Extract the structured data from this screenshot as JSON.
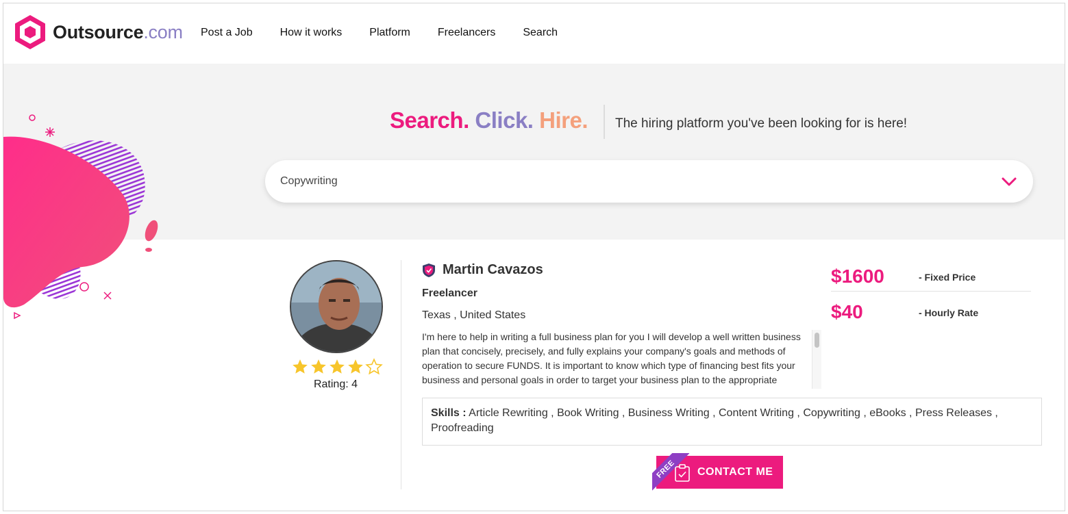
{
  "brand": {
    "name": "Outsource",
    "domain": ".com",
    "primary_color": "#ec1b7e",
    "secondary_color": "#8a7fc4"
  },
  "nav": {
    "items": [
      "Post a Job",
      "How it works",
      "Platform",
      "Freelancers",
      "Search"
    ]
  },
  "hero": {
    "tagline": {
      "part1": "Search.",
      "part2": "Click.",
      "part3": "Hire."
    },
    "subtitle": "The hiring platform you've been looking for is here!",
    "search": {
      "value": "Copywriting",
      "icon": "chevron-down-icon"
    }
  },
  "profile": {
    "name": "Martin Cavazos",
    "role": "Freelancer",
    "location": "Texas , United States",
    "bio": "I'm here to help in writing a full business plan for you I will develop a well written business plan that concisely, precisely, and fully explains your company's goals and methods of operation to secure FUNDS. It is important to know which type of financing best fits your business and personal goals in order to target your business plan to the appropriate",
    "rating": {
      "value": 4,
      "max": 5,
      "label": "Rating: 4"
    },
    "prices": [
      {
        "amount": "$1600",
        "label": "- Fixed Price"
      },
      {
        "amount": "$40",
        "label": "- Hourly Rate"
      }
    ],
    "skills": {
      "label": "Skills :",
      "list": "Article Rewriting , Book Writing , Business Writing , Content Writing , Copywriting , eBooks , Press Releases , Proofreading"
    },
    "contact": {
      "label": "CONTACT ME",
      "ribbon": "FREE"
    }
  }
}
